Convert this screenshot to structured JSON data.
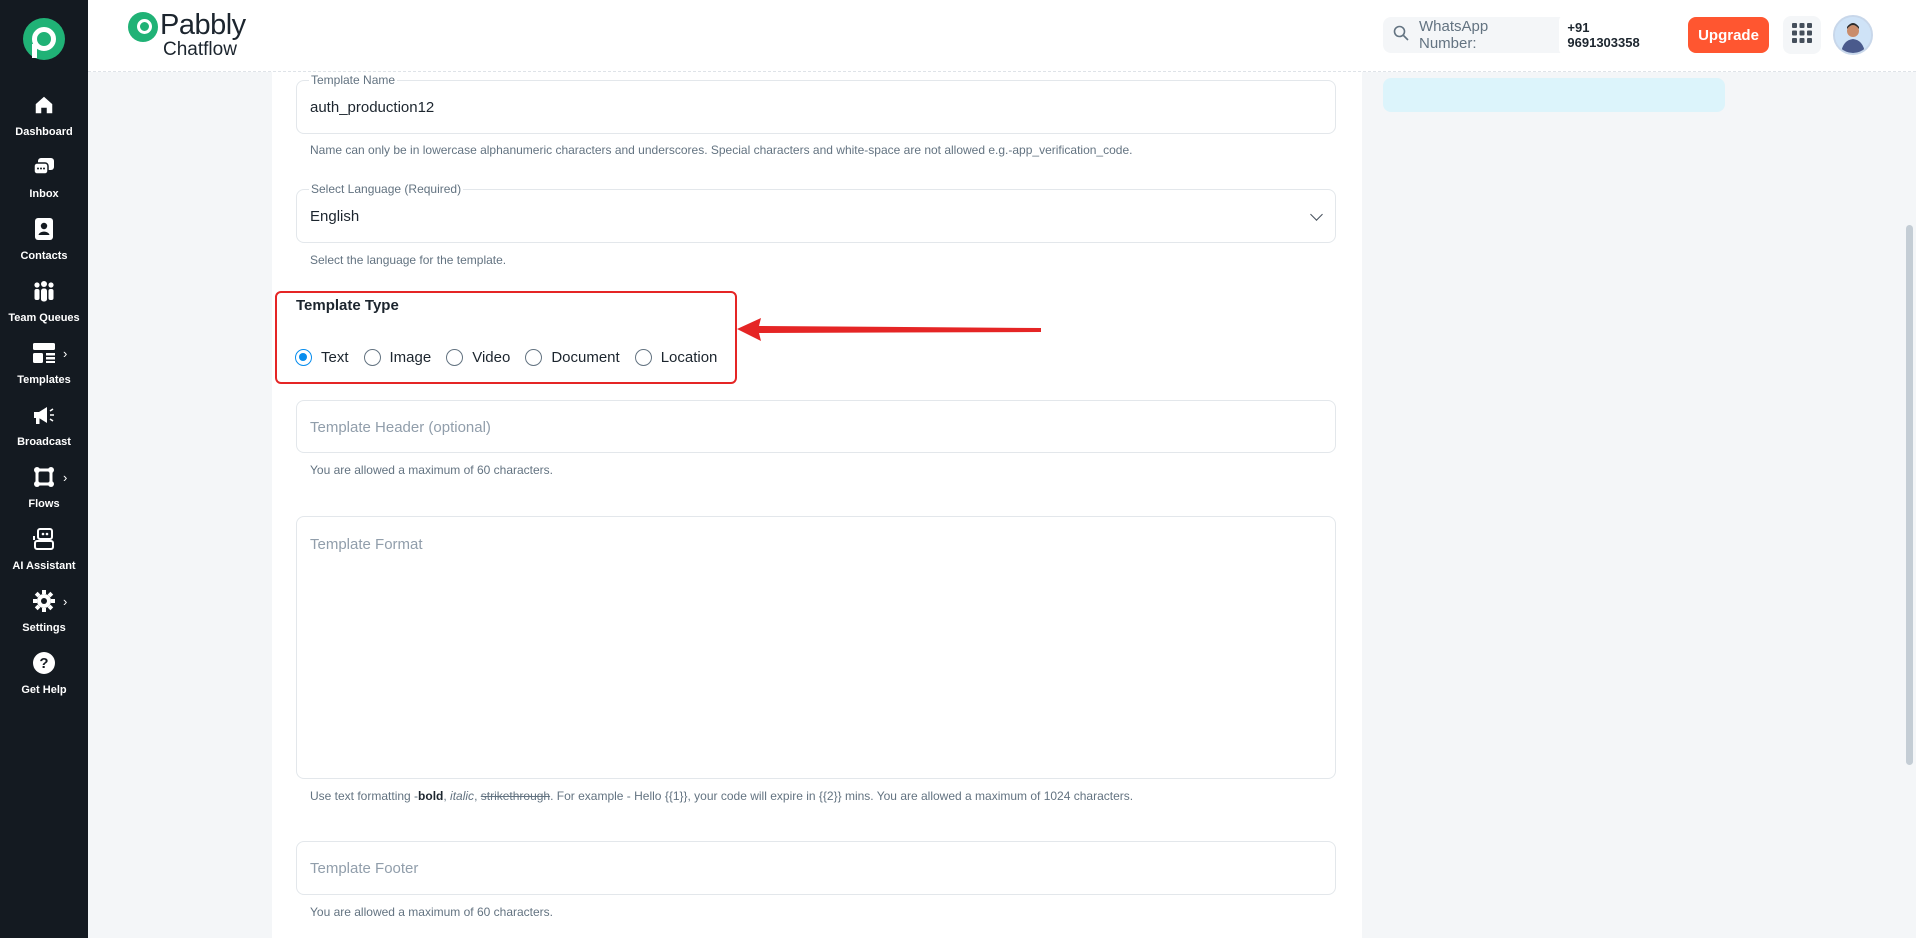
{
  "sidebar": {
    "items": [
      {
        "label": "Dashboard"
      },
      {
        "label": "Inbox"
      },
      {
        "label": "Contacts"
      },
      {
        "label": "Team Queues"
      },
      {
        "label": "Templates"
      },
      {
        "label": "Broadcast"
      },
      {
        "label": "Flows"
      },
      {
        "label": "AI Assistant"
      },
      {
        "label": "Settings"
      },
      {
        "label": "Get Help"
      }
    ]
  },
  "header": {
    "brand_name": "Pabbly",
    "brand_sub": "Chatflow",
    "search_label": "WhatsApp Number:",
    "whatsapp_number": "+91 9691303358",
    "upgrade_label": "Upgrade"
  },
  "form": {
    "template_name": {
      "label": "Template Name",
      "value": "auth_production12",
      "helper": "Name can only be in lowercase alphanumeric characters and underscores. Special characters and white-space are not allowed e.g.-app_verification_code."
    },
    "language": {
      "label": "Select Language (Required)",
      "value": "English",
      "helper": "Select the language for the template."
    },
    "template_type": {
      "title": "Template Type",
      "options": [
        "Text",
        "Image",
        "Video",
        "Document",
        "Location"
      ],
      "selected": "Text"
    },
    "header_field": {
      "placeholder": "Template Header (optional)",
      "helper": "You are allowed a maximum of 60 characters."
    },
    "format_field": {
      "placeholder": "Template Format",
      "helper_prefix": "Use text formatting -",
      "helper_bold": "bold",
      "helper_sep1": ", ",
      "helper_italic": "italic",
      "helper_sep2": ", ",
      "helper_strike": "strikethrough",
      "helper_suffix": ". For example - Hello {{1}}, your code will expire in {{2}} mins. You are allowed a maximum of 1024 characters."
    },
    "footer_field": {
      "placeholder": "Template Footer",
      "helper": "You are allowed a maximum of 60 characters."
    }
  },
  "colors": {
    "accent": "#078dee",
    "brand_green": "#20b276",
    "upgrade": "#ff5630",
    "highlight_red": "#e52525"
  }
}
